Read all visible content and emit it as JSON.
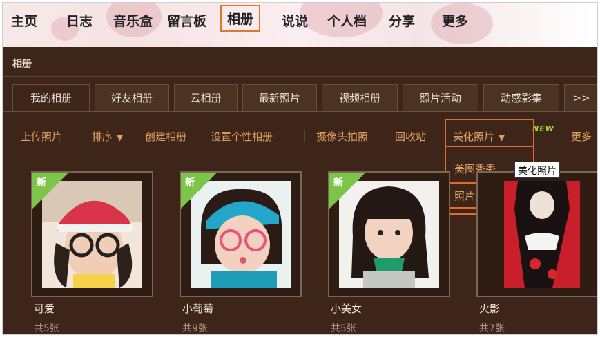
{
  "nav": {
    "items": [
      "主页",
      "日志",
      "音乐盒",
      "留言板",
      "相册",
      "说说",
      "个人档",
      "分享",
      "更多"
    ],
    "active_index": 4,
    "active_color": "#e0782c"
  },
  "panel": {
    "title": "相册"
  },
  "tabs": [
    "我的相册",
    "好友相册",
    "云相册",
    "最新照片",
    "视频相册",
    "照片活动",
    "动感影集",
    ">>"
  ],
  "toolbar": {
    "upload": "上传照片",
    "sort": "排序",
    "create": "创建相册",
    "personalize": "设置个性相册",
    "camera": "摄像头拍照",
    "recycle": "回收站",
    "beautify": "美化照片",
    "new_tag": "NEW",
    "more": "更多"
  },
  "dropdown": {
    "items": [
      "美图秀秀",
      "照片编辑器"
    ],
    "highlight_color": "#e36b2c"
  },
  "tooltip": "美化照片",
  "albums": [
    {
      "name": "可爱",
      "count": "共5张",
      "badge": "新"
    },
    {
      "name": "小葡萄",
      "count": "共9张",
      "badge": "新"
    },
    {
      "name": "小美女",
      "count": "共5张",
      "badge": "新"
    },
    {
      "name": "火影",
      "count": "共7张",
      "badge": ""
    }
  ],
  "icons": {
    "caret": "caret-down-icon",
    "more_tabs": "double-chevron-icon"
  },
  "colors": {
    "panel_bg": "#3d2619",
    "link": "#e2a163",
    "badge": "#7dc54a"
  }
}
